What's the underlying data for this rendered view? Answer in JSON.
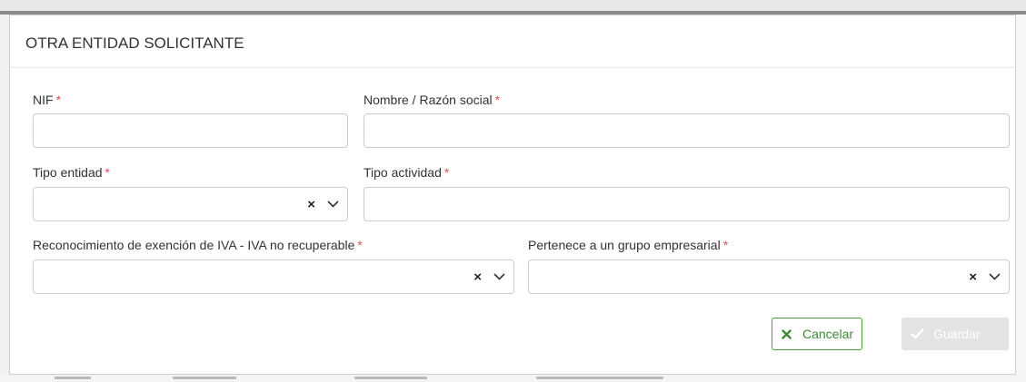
{
  "modal": {
    "title": "OTRA ENTIDAD SOLICITANTE"
  },
  "fields": {
    "nif": {
      "label": "NIF",
      "value": ""
    },
    "nombre": {
      "label": "Nombre / Razón social",
      "value": ""
    },
    "tipo_entidad": {
      "label": "Tipo entidad",
      "value": ""
    },
    "tipo_actividad": {
      "label": "Tipo actividad",
      "value": ""
    },
    "reconocimiento": {
      "label": "Reconocimiento de exención de IVA - IVA no recuperable",
      "value": ""
    },
    "grupo": {
      "label": "Pertenece a un grupo empresarial",
      "value": ""
    }
  },
  "required_marker": "*",
  "buttons": {
    "cancel": {
      "label": "Cancelar",
      "icon": "times-icon"
    },
    "save": {
      "label": "Guardar",
      "icon": "check-icon",
      "disabled": true
    }
  },
  "colors": {
    "required": "#d9534f",
    "cancel_accent": "#3e8a34",
    "save_disabled": "#e3e3e3"
  }
}
